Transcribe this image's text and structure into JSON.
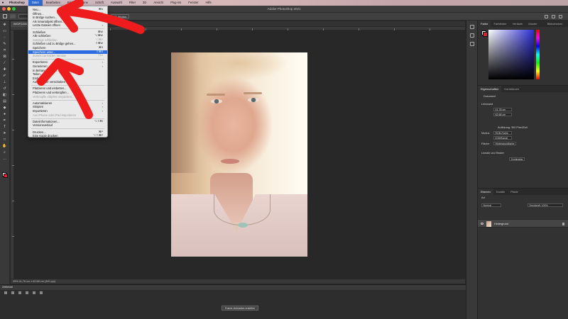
{
  "menubar": {
    "app": "Photoshop",
    "items": [
      "Datei",
      "Bearbeiten",
      "Bild",
      "Ebene",
      "Schrift",
      "Auswahl",
      "Filter",
      "3D",
      "Ansicht",
      "Plug-ins",
      "Fenster",
      "Hilfe"
    ],
    "active_index": 0,
    "clock": "Mo. 15. März 17:49:50"
  },
  "window": {
    "title": "Adobe Photoshop 2021"
  },
  "options": {
    "autoselect_label": "Ebene",
    "transform_label": "Transformationsstrg. einbl.",
    "align_1": "Zentriert",
    "align_2": "Unterteilt",
    "btn_label": "3D-Modus"
  },
  "document": {
    "tab_label": "IMGP2206.jpg @ 25% (RGB/8)",
    "status": "25%   41,78 cm x 62,68 cm (300 ppi)"
  },
  "file_menu": {
    "items": [
      {
        "label": "Neu...",
        "shortcut": "⌘N",
        "type": "item"
      },
      {
        "label": "Öffnen...",
        "shortcut": "⌘O",
        "type": "item"
      },
      {
        "label": "In Bridge suchen...",
        "shortcut": "⌥⌘O",
        "type": "item"
      },
      {
        "label": "Als Smartobjekt öffnen...",
        "shortcut": "",
        "type": "item"
      },
      {
        "label": "Letzte Dateien öffnen",
        "shortcut": "",
        "type": "submenu"
      },
      {
        "type": "sep"
      },
      {
        "label": "Schließen",
        "shortcut": "⌘W",
        "type": "item"
      },
      {
        "label": "Alle schließen",
        "shortcut": "⌥⌘W",
        "type": "item"
      },
      {
        "label": "Sonstige schließen",
        "shortcut": "⌥⌘P",
        "type": "disabled"
      },
      {
        "label": "Schließen und zu Bridge gehen...",
        "shortcut": "⇧⌘W",
        "type": "item"
      },
      {
        "label": "Speichern",
        "shortcut": "⌘S",
        "type": "item"
      },
      {
        "label": "Speichern unter...",
        "shortcut": "⇧⌘S",
        "type": "selected"
      },
      {
        "label": "Zurück zur letzten Version",
        "shortcut": "F12",
        "type": "disabled"
      },
      {
        "type": "sep"
      },
      {
        "label": "Exportieren",
        "shortcut": "",
        "type": "submenu"
      },
      {
        "label": "Generieren",
        "shortcut": "",
        "type": "submenu"
      },
      {
        "label": "In Behance teilen...",
        "shortcut": "",
        "type": "item"
      },
      {
        "label": "Teilen...",
        "shortcut": "",
        "type": "item"
      },
      {
        "label": "Einbetten...",
        "shortcut": "",
        "type": "item"
      },
      {
        "label": "Auf Rechner verschieben",
        "shortcut": "",
        "type": "item"
      },
      {
        "type": "sep"
      },
      {
        "label": "Platzieren und einbetten...",
        "shortcut": "",
        "type": "item"
      },
      {
        "label": "Platzieren und verknüpfen...",
        "shortcut": "",
        "type": "item"
      },
      {
        "label": "Verknüpfte Objekte verpacken...",
        "shortcut": "",
        "type": "disabled"
      },
      {
        "type": "sep"
      },
      {
        "label": "Automatisieren",
        "shortcut": "",
        "type": "submenu"
      },
      {
        "label": "Skripten",
        "shortcut": "",
        "type": "submenu"
      },
      {
        "label": "Importieren",
        "shortcut": "",
        "type": "submenu"
      },
      {
        "label": "Aus iPhone oder iPad importieren",
        "shortcut": "",
        "type": "disabled"
      },
      {
        "type": "sep"
      },
      {
        "label": "Dateiinformationen...",
        "shortcut": "⌥⇧⌘I",
        "type": "item"
      },
      {
        "label": "Versionsverlauf",
        "shortcut": "",
        "type": "item"
      },
      {
        "type": "sep"
      },
      {
        "label": "Drucken...",
        "shortcut": "⌘P",
        "type": "item"
      },
      {
        "label": "Eine Kopie drucken",
        "shortcut": "⌥⇧⌘P",
        "type": "item"
      }
    ]
  },
  "color_panel": {
    "tabs": [
      "Farbe",
      "Farbfelder",
      "Verläufe",
      "Muster"
    ]
  },
  "libraries_label": "Bibliotheken",
  "properties_panel": {
    "tabs": [
      "Eigenschaften",
      "Korrekturen"
    ],
    "doc_label": "Dokument",
    "canvas_label": "Leinwand",
    "width": "41,78 cm",
    "height": "62,68 cm",
    "resolution": "Auflösung: 300 Pixel/Zoll",
    "mode_label": "Modus",
    "mode_value": "RGB-Farbe",
    "depth_value": "8 Bit/Kanal",
    "fill_label": "Fläche",
    "fill_value": "Hintergrundfarbe",
    "rulers_label": "Lineale und Raster",
    "units_value": "Zentimeter"
  },
  "layers_panel": {
    "tabs": [
      "Ebenen",
      "Kanäle",
      "Pfade"
    ],
    "kind_label": "Art",
    "blend_label": "Normal",
    "opacity_label": "Deckkraft: 100%",
    "layer_name": "Hintergrund"
  },
  "timeline": {
    "title": "Zeitleiste",
    "create_label": "Frame-Animation erstellen"
  }
}
